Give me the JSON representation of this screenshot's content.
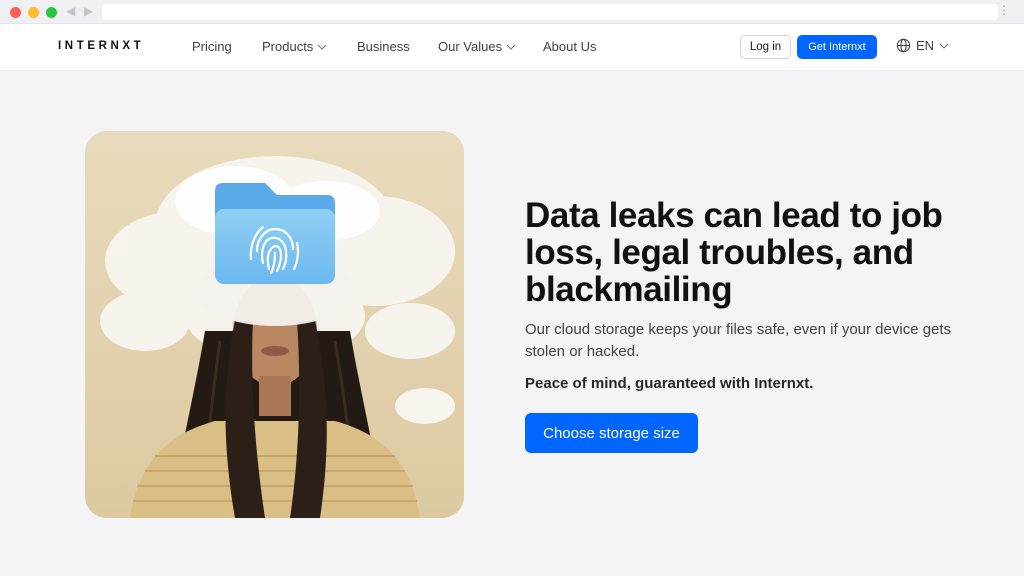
{
  "header": {
    "logo": "INTERNXT",
    "nav": [
      {
        "label": "Pricing"
      },
      {
        "label": "Products"
      },
      {
        "label": "Business"
      },
      {
        "label": "Our Values"
      },
      {
        "label": "About Us"
      }
    ],
    "login_label": "Log in",
    "cta_label": "Get Internxt",
    "language": "EN"
  },
  "hero": {
    "title": "Data leaks can lead to job loss, legal troubles, and blackmailing",
    "subtitle": "Our cloud storage keeps your files safe, even if your device gets stolen or hacked.",
    "tagline": "Peace of mind, guaranteed with Internxt.",
    "button_label": "Choose storage size"
  },
  "colors": {
    "brand_blue": "#0066ff",
    "page_background": "#f4f4f6",
    "illustration_beige": "#e5d6b3"
  },
  "icons": [
    "globe-icon",
    "chevron-down-icon",
    "fingerprint-icon",
    "folder-icon"
  ]
}
